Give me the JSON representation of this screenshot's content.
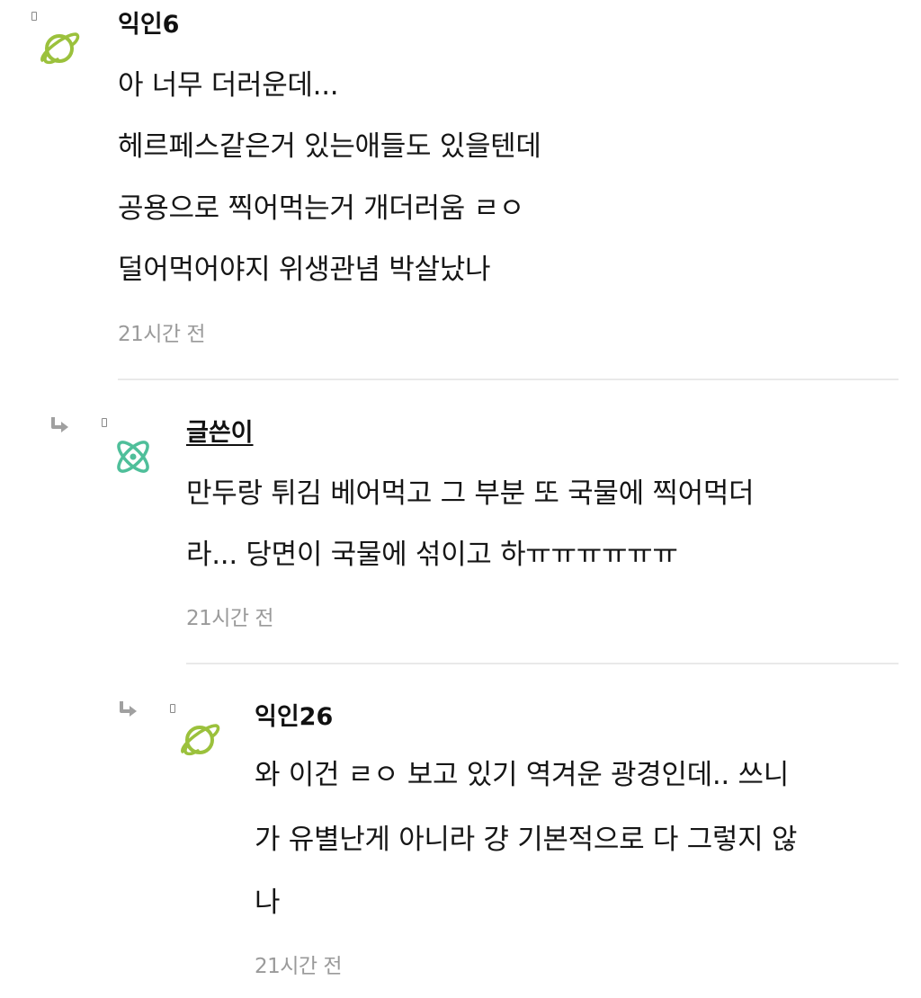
{
  "comments": [
    {
      "nickname": "익인6",
      "lines": [
        "아 너무 더러운데...",
        "헤르페스같은거 있는애들도 있을텐데",
        "공용으로 찍어먹는거 개더러움 ㄹㅇ",
        "덜어먹어야지 위생관념 박살났나"
      ],
      "time": "21시간 전",
      "avatar_icon": "planet-icon",
      "avatar_color": "#9bc13c"
    },
    {
      "nickname": "글쓴이",
      "lines": [
        "만두랑 튀김 베어먹고 그 부분 또 국물에 찍어먹더",
        "라... 당면이 국물에 섞이고 하ㅠㅠㅠㅠㅠㅠ"
      ],
      "time": "21시간 전",
      "avatar_icon": "atom-icon",
      "avatar_color": "#4fbf9a"
    },
    {
      "nickname": "익인26",
      "lines": [
        "와 이건 ㄹㅇ 보고 있기 역겨운 광경인데.. 쓰니",
        "가 유별난게 아니라 걍 기본적으로 다 그렇지 않",
        "나"
      ],
      "time": "21시간 전",
      "avatar_icon": "planet-icon",
      "avatar_color": "#9bc13c"
    }
  ],
  "colors": {
    "text": "#161616",
    "time": "#9a9a9a",
    "divider": "#e9e9e9",
    "reply_arrow": "#9a9a9a"
  }
}
